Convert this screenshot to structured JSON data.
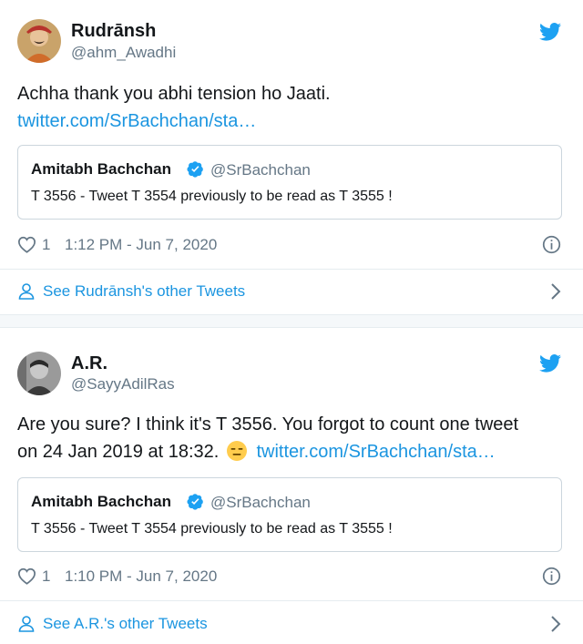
{
  "tweets": [
    {
      "name": "Rudrānsh",
      "handle": "@ahm_Awadhi",
      "text": "Achha thank you abhi tension ho Jaati.",
      "link": "twitter.com/SrBachchan/sta…",
      "quote": {
        "name": "Amitabh Bachchan",
        "handle": "@SrBachchan",
        "text": "T 3556 - Tweet T 3554 previously to be read as T 3555 !"
      },
      "likes": "1",
      "time": "1:12 PM - Jun 7, 2020",
      "more_label": "See Rudrānsh's other Tweets"
    },
    {
      "name": "A.R.",
      "handle": "@SayyAdilRas",
      "text_line1": "Are you sure? I think it's T 3556. You forgot to count one tweet",
      "text_line2": "on 24 Jan 2019 at 18:32.",
      "link": "twitter.com/SrBachchan/sta…",
      "quote": {
        "name": "Amitabh Bachchan",
        "handle": "@SrBachchan",
        "text": "T 3556 - Tweet T 3554 previously to be read as T 3555 !"
      },
      "likes": "1",
      "time": "1:10 PM - Jun 7, 2020",
      "more_label": "See A.R.'s other Tweets"
    }
  ],
  "icons": {
    "bird": "twitter-bird-icon",
    "verified": "verified-badge-icon",
    "heart": "heart-icon",
    "info": "info-icon",
    "user": "user-icon",
    "chevron": "chevron-right-icon",
    "emoji": "expressionless-face-emoji"
  },
  "colors": {
    "brand": "#1da1f2",
    "link": "#1b95e0",
    "muted": "#657786",
    "text": "#14171a"
  }
}
